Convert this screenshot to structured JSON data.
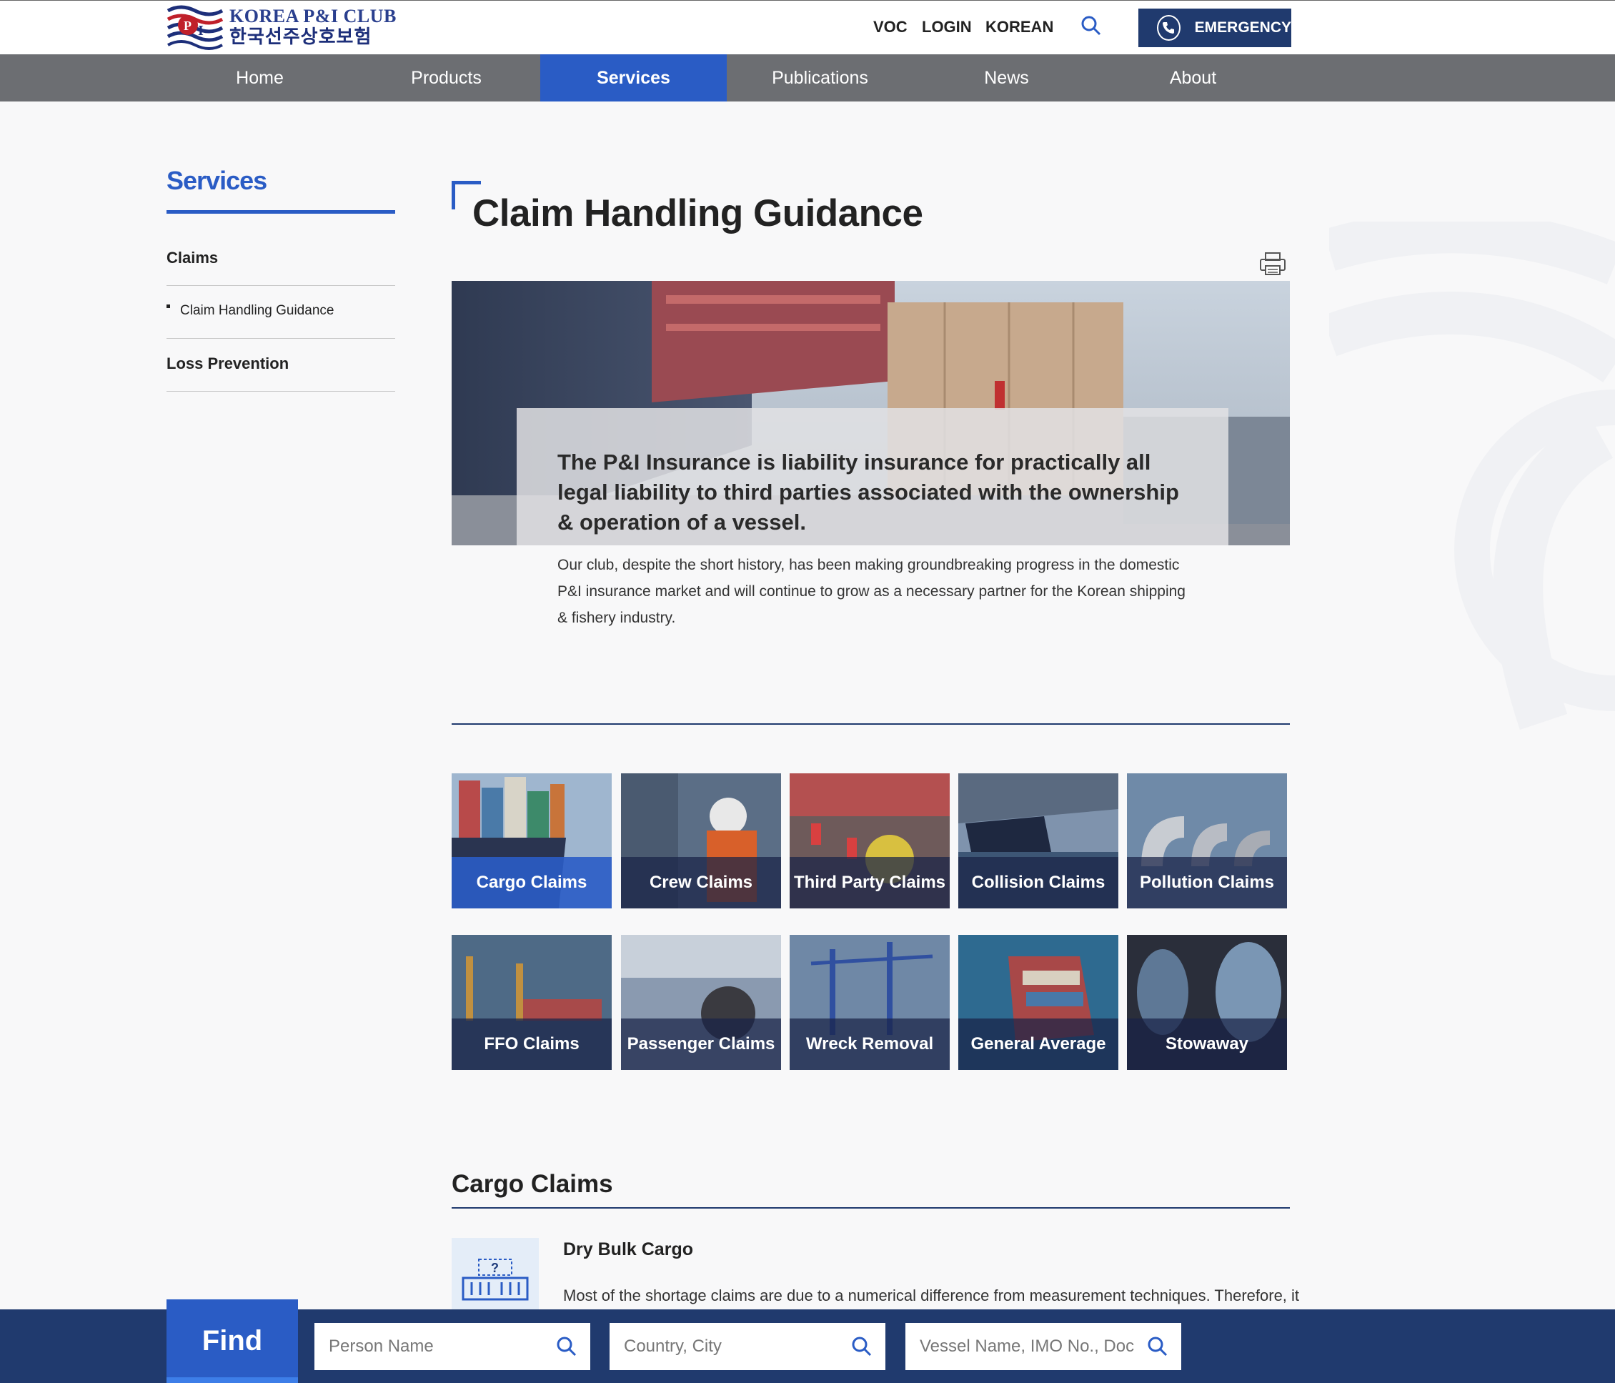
{
  "header": {
    "logo_en": "KOREA P&I CLUB",
    "logo_ko": "한국선주상호보험",
    "util_links": [
      "VOC",
      "LOGIN",
      "KOREAN"
    ],
    "emergency_label": "EMERGENCY"
  },
  "nav": {
    "items": [
      "Home",
      "Products",
      "Services",
      "Publications",
      "News",
      "About"
    ],
    "active": "Services"
  },
  "sidebar": {
    "title": "Services",
    "groups": [
      {
        "label": "Claims",
        "children": [
          "Claim Handling Guidance"
        ]
      },
      {
        "label": "Loss Prevention",
        "children": []
      }
    ]
  },
  "main": {
    "title": "Claim Handling Guidance",
    "hero_lead": "The P&I Insurance is liability insurance for practically all legal liability to third parties associated with the ownership & operation of a vessel.",
    "hero_body": "Our club, despite the short history, has been making groundbreaking progress in the domestic P&I insurance market and will continue to grow as a necessary partner for the Korean shipping & fishery industry.",
    "tiles": [
      "Cargo Claims",
      "Crew Claims",
      "Third Party Claims",
      "Collision Claims",
      "Pollution Claims",
      "FFO Claims",
      "Passenger Claims",
      "Wreck Removal",
      "General Average",
      "Stowaway"
    ],
    "active_tile": "Cargo Claims",
    "section": {
      "title": "Cargo Claims",
      "subtitle": "Dry Bulk Cargo",
      "text": "Most of the shortage claims are due to a numerical difference from measurement techniques. Therefore, it"
    }
  },
  "find": {
    "label": "Find",
    "inputs": [
      {
        "placeholder": "Person Name",
        "value": ""
      },
      {
        "placeholder": "Country, City",
        "value": ""
      },
      {
        "placeholder": "Vessel Name, IMO No., Doc No",
        "value": ""
      }
    ]
  },
  "colors": {
    "accent": "#2a5cc5",
    "navy": "#203a6e",
    "nav_bg": "#6c6e72"
  }
}
